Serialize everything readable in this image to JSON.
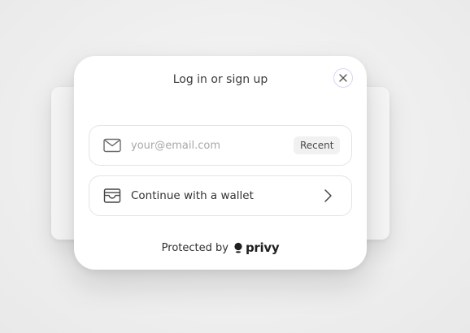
{
  "modal": {
    "title": "Log in or sign up",
    "close_icon": "close-icon"
  },
  "email": {
    "icon": "mail-icon",
    "placeholder": "your@email.com",
    "value": "",
    "badge": "Recent"
  },
  "wallet": {
    "icon": "wallet-icon",
    "label": "Continue with a wallet",
    "chevron_icon": "chevron-right-icon"
  },
  "footer": {
    "text": "Protected by",
    "brand": "privy",
    "brand_icon": "privy-logo-icon"
  },
  "colors": {
    "close_border": "#d9d7f3",
    "row_border": "#e4e4e4",
    "badge_bg": "#f1f1f1",
    "placeholder": "#a8a8a8"
  }
}
